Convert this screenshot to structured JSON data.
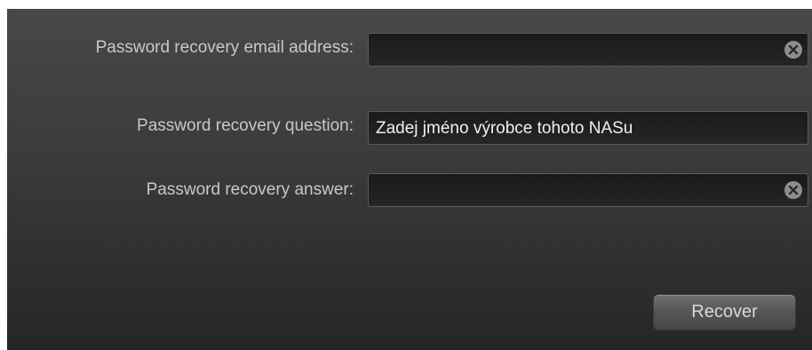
{
  "form": {
    "email_label": "Password recovery email address:",
    "email_value": "",
    "question_label": "Password recovery question:",
    "question_value": "Zadej jméno výrobce tohoto NASu",
    "answer_label": "Password recovery answer:",
    "answer_value": "",
    "recover_label": "Recover"
  },
  "icons": {
    "clear": "clear-icon"
  }
}
